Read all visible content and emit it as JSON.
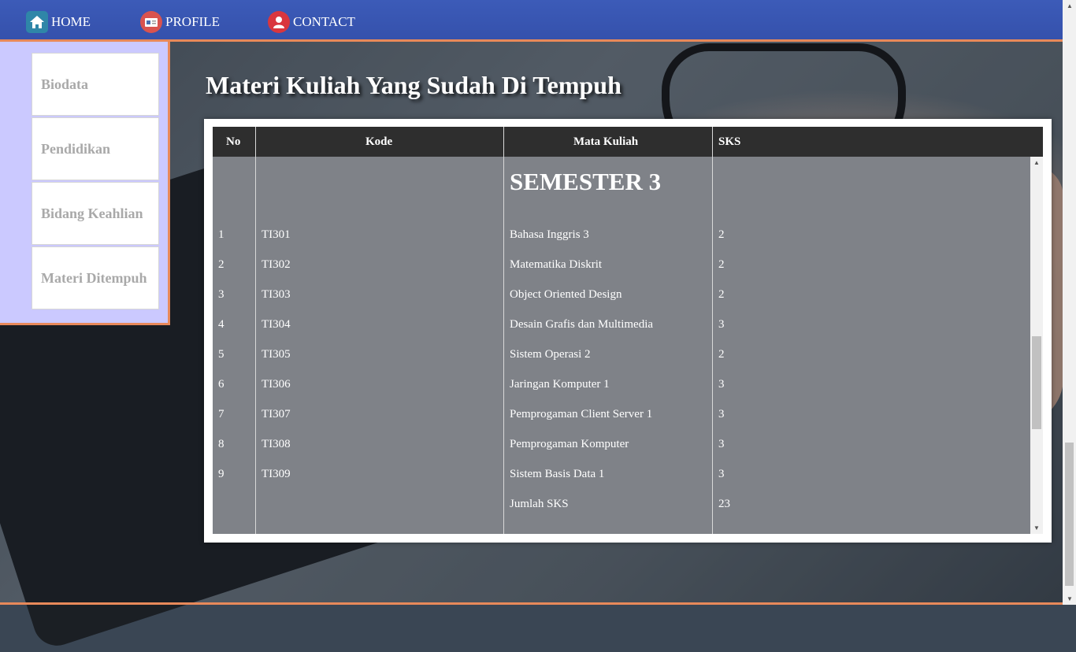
{
  "nav": {
    "items": [
      {
        "label": "HOME",
        "icon": "home-icon",
        "color": "#2f86a8"
      },
      {
        "label": "PROFILE",
        "icon": "id-card-icon",
        "color": "#d9534f"
      },
      {
        "label": "CONTACT",
        "icon": "user-icon",
        "color": "#d9363e"
      }
    ],
    "accent": "#e8895a"
  },
  "sidebar": {
    "items": [
      {
        "label": "Biodata"
      },
      {
        "label": "Pendidikan"
      },
      {
        "label": "Bidang Keahlian"
      },
      {
        "label": "Materi Ditempuh"
      }
    ]
  },
  "main": {
    "title": "Materi Kuliah Yang Sudah Di Tempuh",
    "table": {
      "headers": [
        "No",
        "Kode",
        "Mata Kuliah",
        "SKS"
      ],
      "semester": "SEMESTER 3",
      "rows": [
        {
          "no": "1",
          "kode": "TI301",
          "matkul": "Bahasa Inggris 3",
          "sks": "2"
        },
        {
          "no": "2",
          "kode": "TI302",
          "matkul": "Matematika Diskrit",
          "sks": "2"
        },
        {
          "no": "3",
          "kode": "TI303",
          "matkul": "Object Oriented Design",
          "sks": "2"
        },
        {
          "no": "4",
          "kode": "TI304",
          "matkul": "Desain Grafis dan Multimedia",
          "sks": "3"
        },
        {
          "no": "5",
          "kode": "TI305",
          "matkul": "Sistem Operasi 2",
          "sks": "2"
        },
        {
          "no": "6",
          "kode": "TI306",
          "matkul": "Jaringan Komputer 1",
          "sks": "3"
        },
        {
          "no": "7",
          "kode": "TI307",
          "matkul": "Pemprogaman Client Server 1",
          "sks": "3"
        },
        {
          "no": "8",
          "kode": "TI308",
          "matkul": "Pemprogaman Komputer",
          "sks": "3"
        },
        {
          "no": "9",
          "kode": "TI309",
          "matkul": "Sistem Basis Data 1",
          "sks": "3"
        }
      ],
      "total": {
        "label": "Jumlah SKS",
        "value": "23"
      }
    }
  }
}
